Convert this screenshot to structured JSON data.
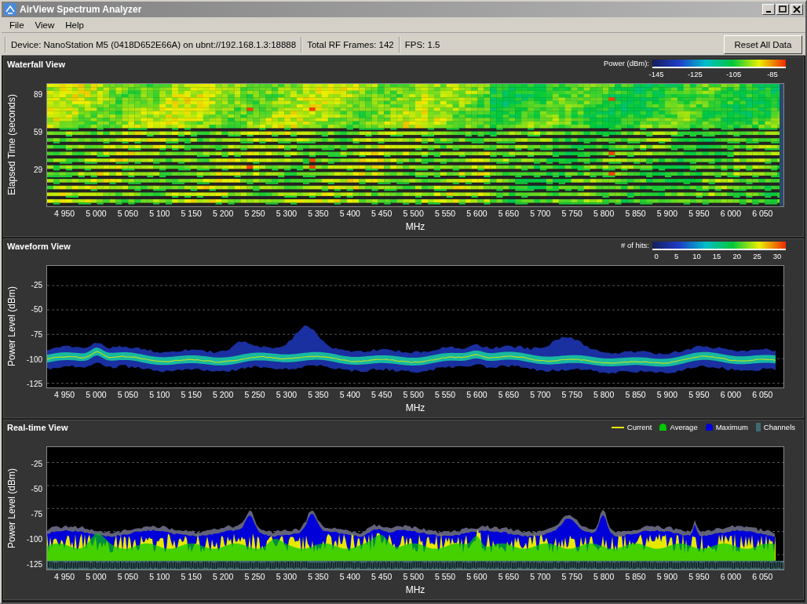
{
  "window": {
    "title": "AirView Spectrum Analyzer"
  },
  "menu": [
    "File",
    "View",
    "Help"
  ],
  "toolbar": {
    "fields": [
      "Device: NanoStation M5 (0418D652E66A) on ubnt://192.168.1.3:18888",
      "Total RF Frames: 142",
      "FPS: 1.5"
    ],
    "button": "Reset All Data"
  },
  "panels": [
    {
      "kind": "waterfall",
      "title": "Waterfall View",
      "legend": {
        "kind": "scale",
        "label": "Power (dBm):",
        "ticks": [
          "-145",
          "-125",
          "-105",
          "-85"
        ]
      },
      "ylabel": "Elapsed Time (seconds)",
      "yticks": [
        "89",
        "59",
        "29"
      ],
      "xticks": [
        "4 950",
        "5 000",
        "5 050",
        "5 100",
        "5 150",
        "5 200",
        "5 250",
        "5 300",
        "5 350",
        "5 400",
        "5 450",
        "5 500",
        "5 550",
        "5 600",
        "5 650",
        "5 700",
        "5 750",
        "5 800",
        "5 850",
        "5 900",
        "5 950",
        "6 000",
        "6 050"
      ],
      "xlabel": "MHz"
    },
    {
      "kind": "waveform",
      "title": "Waveform View",
      "legend": {
        "kind": "scale",
        "label": "# of hits:",
        "ticks": [
          "0",
          "5",
          "10",
          "15",
          "20",
          "25",
          "30"
        ]
      },
      "ylabel": "Power Level (dBm)",
      "yticks": [
        "-25",
        "-50",
        "-75",
        "-100",
        "-125"
      ],
      "xticks": [
        "4 950",
        "5 000",
        "5 050",
        "5 100",
        "5 150",
        "5 200",
        "5 250",
        "5 300",
        "5 350",
        "5 400",
        "5 450",
        "5 500",
        "5 550",
        "5 600",
        "5 650",
        "5 700",
        "5 750",
        "5 800",
        "5 850",
        "5 900",
        "5 950",
        "6 000",
        "6 050"
      ],
      "xlabel": "MHz"
    },
    {
      "kind": "realtime",
      "title": "Real-time View",
      "legend": {
        "kind": "series",
        "items": [
          {
            "kind": "line",
            "label": "Current",
            "color": "#e8e800"
          },
          {
            "kind": "blob",
            "label": "Average",
            "color": "#00c800"
          },
          {
            "kind": "blob",
            "label": "Maximum",
            "color": "#0000d8"
          },
          {
            "kind": "bar",
            "label": "Channels",
            "color": "#3e6b70"
          }
        ]
      },
      "ylabel": "Power Level (dBm)",
      "yticks": [
        "-25",
        "-50",
        "-75",
        "-100",
        "-125"
      ],
      "xticks": [
        "4 950",
        "5 000",
        "5 050",
        "5 100",
        "5 150",
        "5 200",
        "5 250",
        "5 300",
        "5 350",
        "5 400",
        "5 450",
        "5 500",
        "5 550",
        "5 600",
        "5 650",
        "5 700",
        "5 750",
        "5 800",
        "5 850",
        "5 900",
        "5 950",
        "6 000",
        "6 050"
      ],
      "xlabel": "MHz"
    }
  ]
}
